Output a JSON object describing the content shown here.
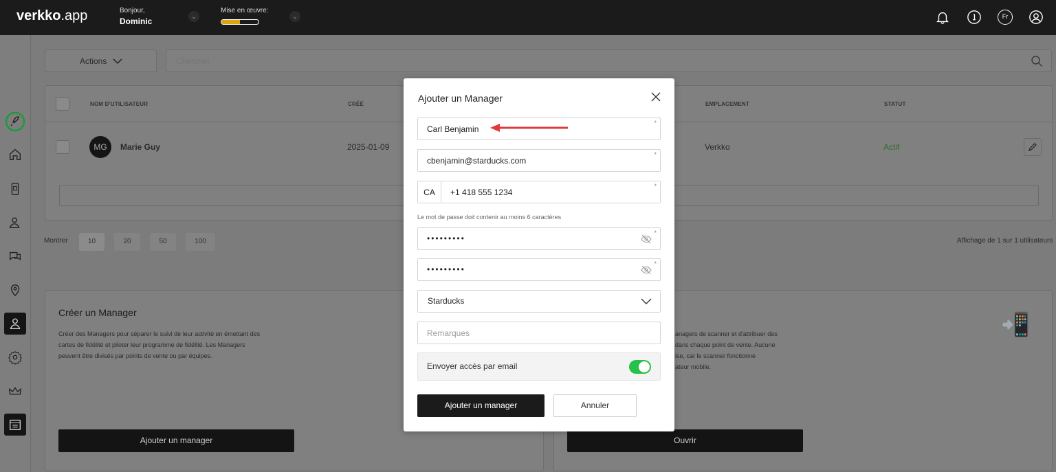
{
  "topbar": {
    "logo_bold": "verkko",
    "logo_rest": ".app",
    "greeting_small": "Bonjour,",
    "greeting_name": "Dominic",
    "launch_label": "Mise en œuvre:",
    "launch_progress": 0.5,
    "lang": "Fr"
  },
  "background": {
    "actions_label": "Actions",
    "search_placeholder": "Chercher",
    "table_headers": [
      "NOM D'UTILISATEUR",
      "CRÉÉ",
      "EMPLACEMENT",
      "STATUT"
    ],
    "row": {
      "initials": "MG",
      "name": "Marie Guy",
      "created": "2025-01-09",
      "location": "Verkko",
      "status": "Actif"
    },
    "show_label": "Montrer",
    "page_sizes": [
      "10",
      "20",
      "50",
      "100"
    ],
    "summary": "Affichage de 1 sur 1 utilisateurs",
    "card_left": {
      "title": "Créer un Manager",
      "body_lines": [
        "Créer des Managers pour séparer le suivi de leur activité en émettant des",
        "cartes de fidélité et piloter leur programme de fidélité. Les Managers",
        "peuvent être divisés par points de vente ou par équipes."
      ],
      "button": "Ajouter un manager"
    },
    "card_right": {
      "body_lines": [
        "anagers de scanner et d'attribuer des",
        "dans chaque point de vente. Aucune",
        "ise, car le scanner fonctionne",
        "ateur mobile."
      ],
      "button": "Ouvrir",
      "icon": "📲"
    }
  },
  "modal": {
    "title": "Ajouter un Manager",
    "name_value": "Carl Benjamin",
    "email_value": "cbenjamin@starducks.com",
    "country_code": "CA",
    "phone_value": "+1 418 555 1234",
    "password_hint": "Le mot de passe doit contenir au moins 6 caractères",
    "password_value": "•••••••••",
    "confirm_value": "•••••••••",
    "location_value": "Starducks",
    "remarks_placeholder": "Remarques",
    "send_access_label": "Envoyer accès par email",
    "send_access_on": true,
    "submit_label": "Ajouter un manager",
    "cancel_label": "Annuler",
    "required_mark": "*"
  },
  "colors": {
    "toggle_on": "#27c04b",
    "accent_arrow": "#e03a3a",
    "progress": "#d9a60f",
    "status_active": "#2f7d2f"
  }
}
